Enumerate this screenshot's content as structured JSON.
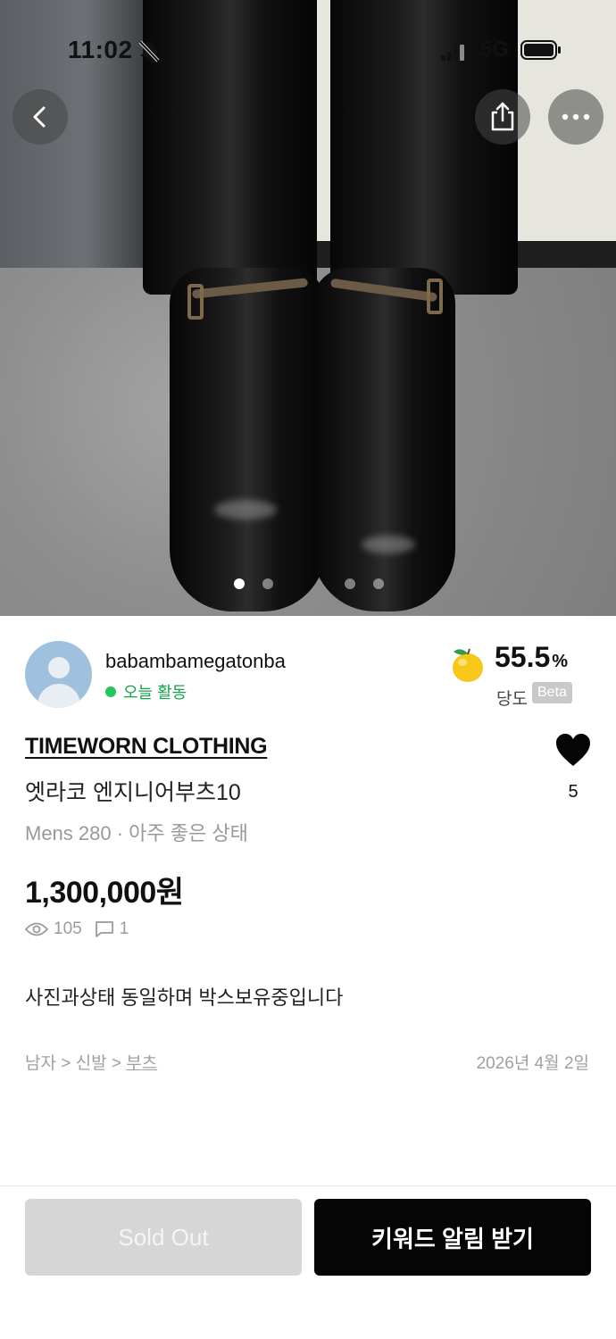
{
  "status_bar": {
    "time": "11:02",
    "network": "5G"
  },
  "hero": {
    "image_description_icon": "photo-boots",
    "page_dots": 4,
    "active_dot": 0
  },
  "seller": {
    "name": "babambamegatonba",
    "activity": "오늘 활동",
    "score": "55.5",
    "score_unit": "%",
    "score_label": "당도",
    "beta_label": "Beta"
  },
  "product": {
    "brand": "TIMEWORN CLOTHING",
    "title": "엣라코 엔지니어부츠10",
    "meta": "Mens 280 · 아주 좋은 상태",
    "price": "1,300,000원",
    "views": "105",
    "comments": "1",
    "likes": "5",
    "description": "사진과상태 동일하며 박스보유중입니다",
    "category_path": [
      "남자",
      "신발",
      "부츠"
    ],
    "date": "2026년 4월 2일"
  },
  "actions": {
    "sold_out_label": "Sold Out",
    "keyword_alert_label": "키워드 알림 받기"
  },
  "colors": {
    "accent_green": "#22c55e",
    "primary_button": "#050505",
    "disabled_button": "#d6d6d6"
  }
}
